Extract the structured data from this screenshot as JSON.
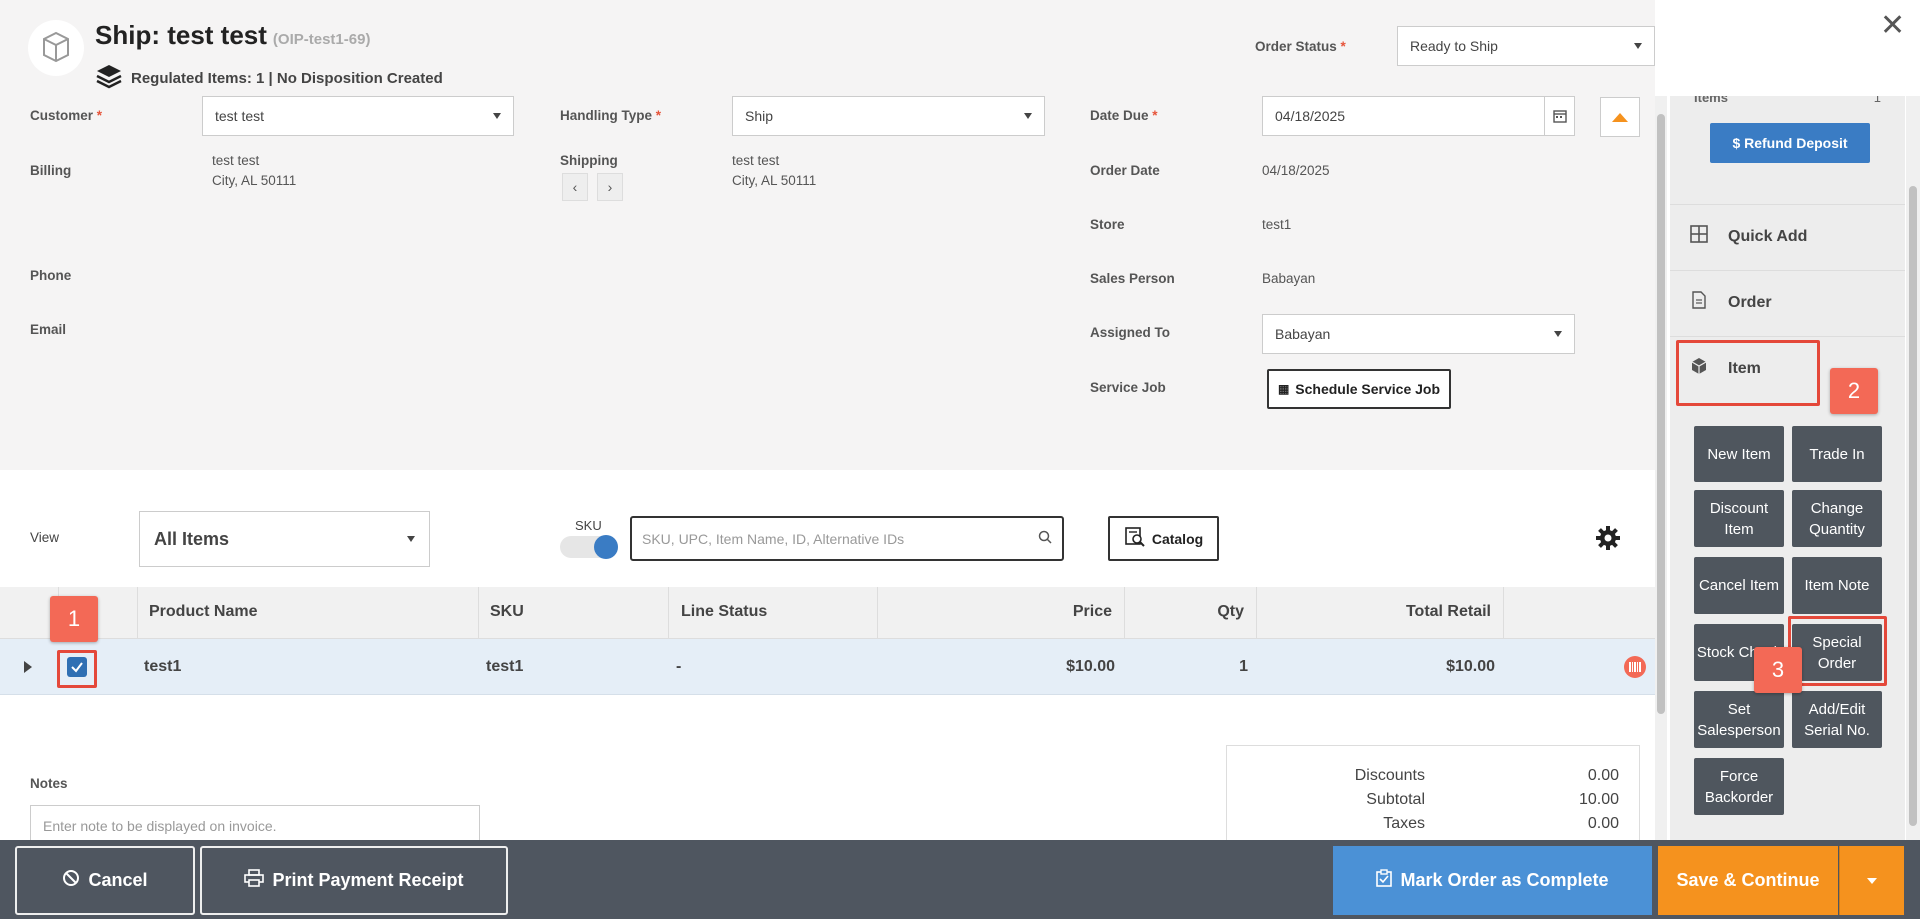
{
  "header": {
    "title": "Ship: test test",
    "order_code": "(OIP-test1-69)",
    "regulated": "Regulated Items: 1 | No Disposition Created"
  },
  "order_status": {
    "label": "Order Status",
    "value": "Ready to Ship"
  },
  "customer": {
    "label": "Customer",
    "value": "test test"
  },
  "billing": {
    "label": "Billing",
    "line1": "test test",
    "line2": "City, AL 50111"
  },
  "phone": {
    "label": "Phone"
  },
  "email": {
    "label": "Email"
  },
  "handling": {
    "label": "Handling Type",
    "value": "Ship"
  },
  "shipping": {
    "label": "Shipping",
    "line1": "test test",
    "line2": "City, AL 50111"
  },
  "date_due": {
    "label": "Date Due",
    "value": "04/18/2025"
  },
  "order_date": {
    "label": "Order Date",
    "value": "04/18/2025"
  },
  "store": {
    "label": "Store",
    "value": "test1"
  },
  "sales_person": {
    "label": "Sales Person",
    "value": "Babayan"
  },
  "assigned_to": {
    "label": "Assigned To",
    "value": "Babayan"
  },
  "service_job": {
    "label": "Service Job",
    "button": "Schedule Service Job"
  },
  "view": {
    "label": "View",
    "value": "All Items"
  },
  "sku_toggle": {
    "label": "SKU"
  },
  "search": {
    "placeholder": "SKU, UPC, Item Name, ID, Alternative IDs"
  },
  "catalog_label": "Catalog",
  "table": {
    "headers": [
      "Product Name",
      "SKU",
      "Line Status",
      "Price",
      "Qty",
      "Total Retail"
    ],
    "rows": [
      {
        "product": "test1",
        "sku": "test1",
        "status": "-",
        "price": "$10.00",
        "qty": "1",
        "total": "$10.00"
      }
    ]
  },
  "notes": {
    "label": "Notes",
    "placeholder": "Enter note to be displayed on invoice."
  },
  "totals": {
    "discounts_label": "Discounts",
    "discounts": "0.00",
    "subtotal_label": "Subtotal",
    "subtotal": "10.00",
    "taxes_label": "Taxes",
    "taxes": "0.00"
  },
  "right_panel": {
    "items_label": "Items",
    "items_count": "1",
    "refund_button": "$ Refund Deposit",
    "menu": [
      "Quick Add",
      "Order",
      "Item"
    ],
    "actions": [
      [
        "New Item",
        "Trade In"
      ],
      [
        "Discount Item",
        "Change Quantity"
      ],
      [
        "Cancel Item",
        "Item Note"
      ],
      [
        "Stock Check",
        "Special Order"
      ],
      [
        "Set Salesperson",
        "Add/Edit Serial No."
      ],
      [
        "Force Backorder"
      ]
    ]
  },
  "callouts": [
    "1",
    "2",
    "3"
  ],
  "footer": {
    "cancel": "Cancel",
    "print": "Print Payment Receipt",
    "complete": "Mark Order as Complete",
    "save": "Save & Continue"
  },
  "colors": {
    "primary": "#3a7cc4",
    "orange": "#f5921e",
    "complete_blue": "#4b91d6",
    "callout": "#f36956"
  }
}
